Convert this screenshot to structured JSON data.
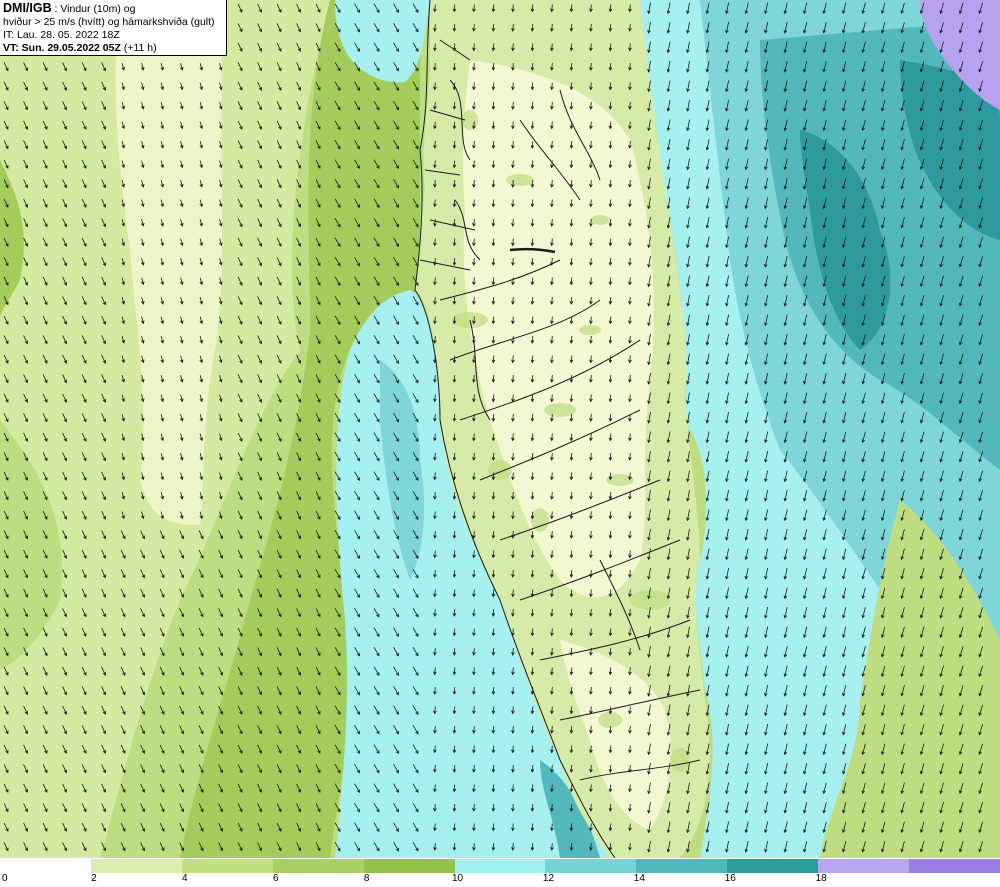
{
  "header": {
    "org": "DMI/IGB",
    "title_rest": " : Vindur (10m) og",
    "line2": "hviður > 25 m/s (hvítt) og hámarkshviða (gult)",
    "line3": "IT: Lau. 28. 05. 2022 18Z",
    "line4_bold": "VT: Sun. 29.05.2022 05Z",
    "line4_rest": " (+11 h)"
  },
  "legend": {
    "colors": [
      "#ffffff",
      "#dceeb0",
      "#c2df86",
      "#a9d062",
      "#93c24a",
      "#a3f0f0",
      "#76d4d6",
      "#4fb9bd",
      "#2c9c9e",
      "#b8a6ef",
      "#9a80e6"
    ],
    "labels": [
      "0",
      "2",
      "4",
      "6",
      "8",
      "10",
      "12",
      "14",
      "16",
      "18"
    ]
  },
  "map": {
    "palette": {
      "land_light": "#f3f8d3",
      "land_mid": "#d7eba8",
      "calm": "#eef6c9",
      "green_light": "#d4eaa0",
      "green_mid": "#bedd80",
      "green_dark": "#a3cc5b",
      "cyan_light": "#a6f0f0",
      "cyan_mid": "#7ed6d8",
      "teal": "#53b8bc",
      "teal_dark": "#2e9a9e",
      "violet": "#b6a2ee"
    },
    "arrow_direction": "from north-northwest"
  }
}
